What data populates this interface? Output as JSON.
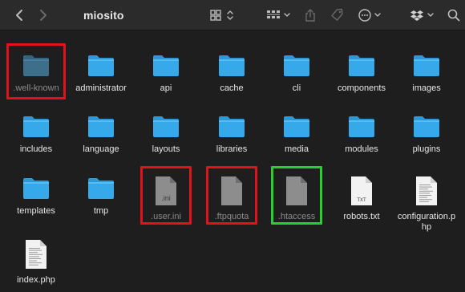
{
  "window": {
    "title": "miosito"
  },
  "toolbar": {
    "icons": [
      "back-icon",
      "forward-icon",
      "icon-view-icon",
      "group-icon",
      "share-icon",
      "tag-icon",
      "more-actions-icon",
      "dropbox-icon",
      "search-icon"
    ]
  },
  "colors": {
    "background": "#1e1e1e",
    "toolbar": "#2b2b2b",
    "folder": "#35a9ea",
    "highlight_red": "#e3111b",
    "highlight_green": "#21d32a"
  },
  "items": [
    {
      "name": ".well-known",
      "kind": "folder",
      "hidden": true,
      "highlight": "red"
    },
    {
      "name": "administrator",
      "kind": "folder"
    },
    {
      "name": "api",
      "kind": "folder"
    },
    {
      "name": "cache",
      "kind": "folder"
    },
    {
      "name": "cli",
      "kind": "folder"
    },
    {
      "name": "components",
      "kind": "folder"
    },
    {
      "name": "images",
      "kind": "folder"
    },
    {
      "name": "includes",
      "kind": "folder"
    },
    {
      "name": "language",
      "kind": "folder"
    },
    {
      "name": "layouts",
      "kind": "folder"
    },
    {
      "name": "libraries",
      "kind": "folder"
    },
    {
      "name": "media",
      "kind": "folder"
    },
    {
      "name": "modules",
      "kind": "folder"
    },
    {
      "name": "plugins",
      "kind": "folder"
    },
    {
      "name": "templates",
      "kind": "folder"
    },
    {
      "name": "tmp",
      "kind": "folder"
    },
    {
      "name": ".user.ini",
      "kind": "file-ini",
      "hidden": true,
      "highlight": "red",
      "badge": ".ini"
    },
    {
      "name": ".ftpquota",
      "kind": "file",
      "hidden": true,
      "highlight": "red"
    },
    {
      "name": ".htaccess",
      "kind": "file",
      "hidden": true,
      "highlight": "green"
    },
    {
      "name": "robots.txt",
      "kind": "file-txt",
      "badge": "TXT"
    },
    {
      "name": "configuration.php",
      "kind": "file-text"
    },
    {
      "name": "index.php",
      "kind": "file-text"
    }
  ]
}
